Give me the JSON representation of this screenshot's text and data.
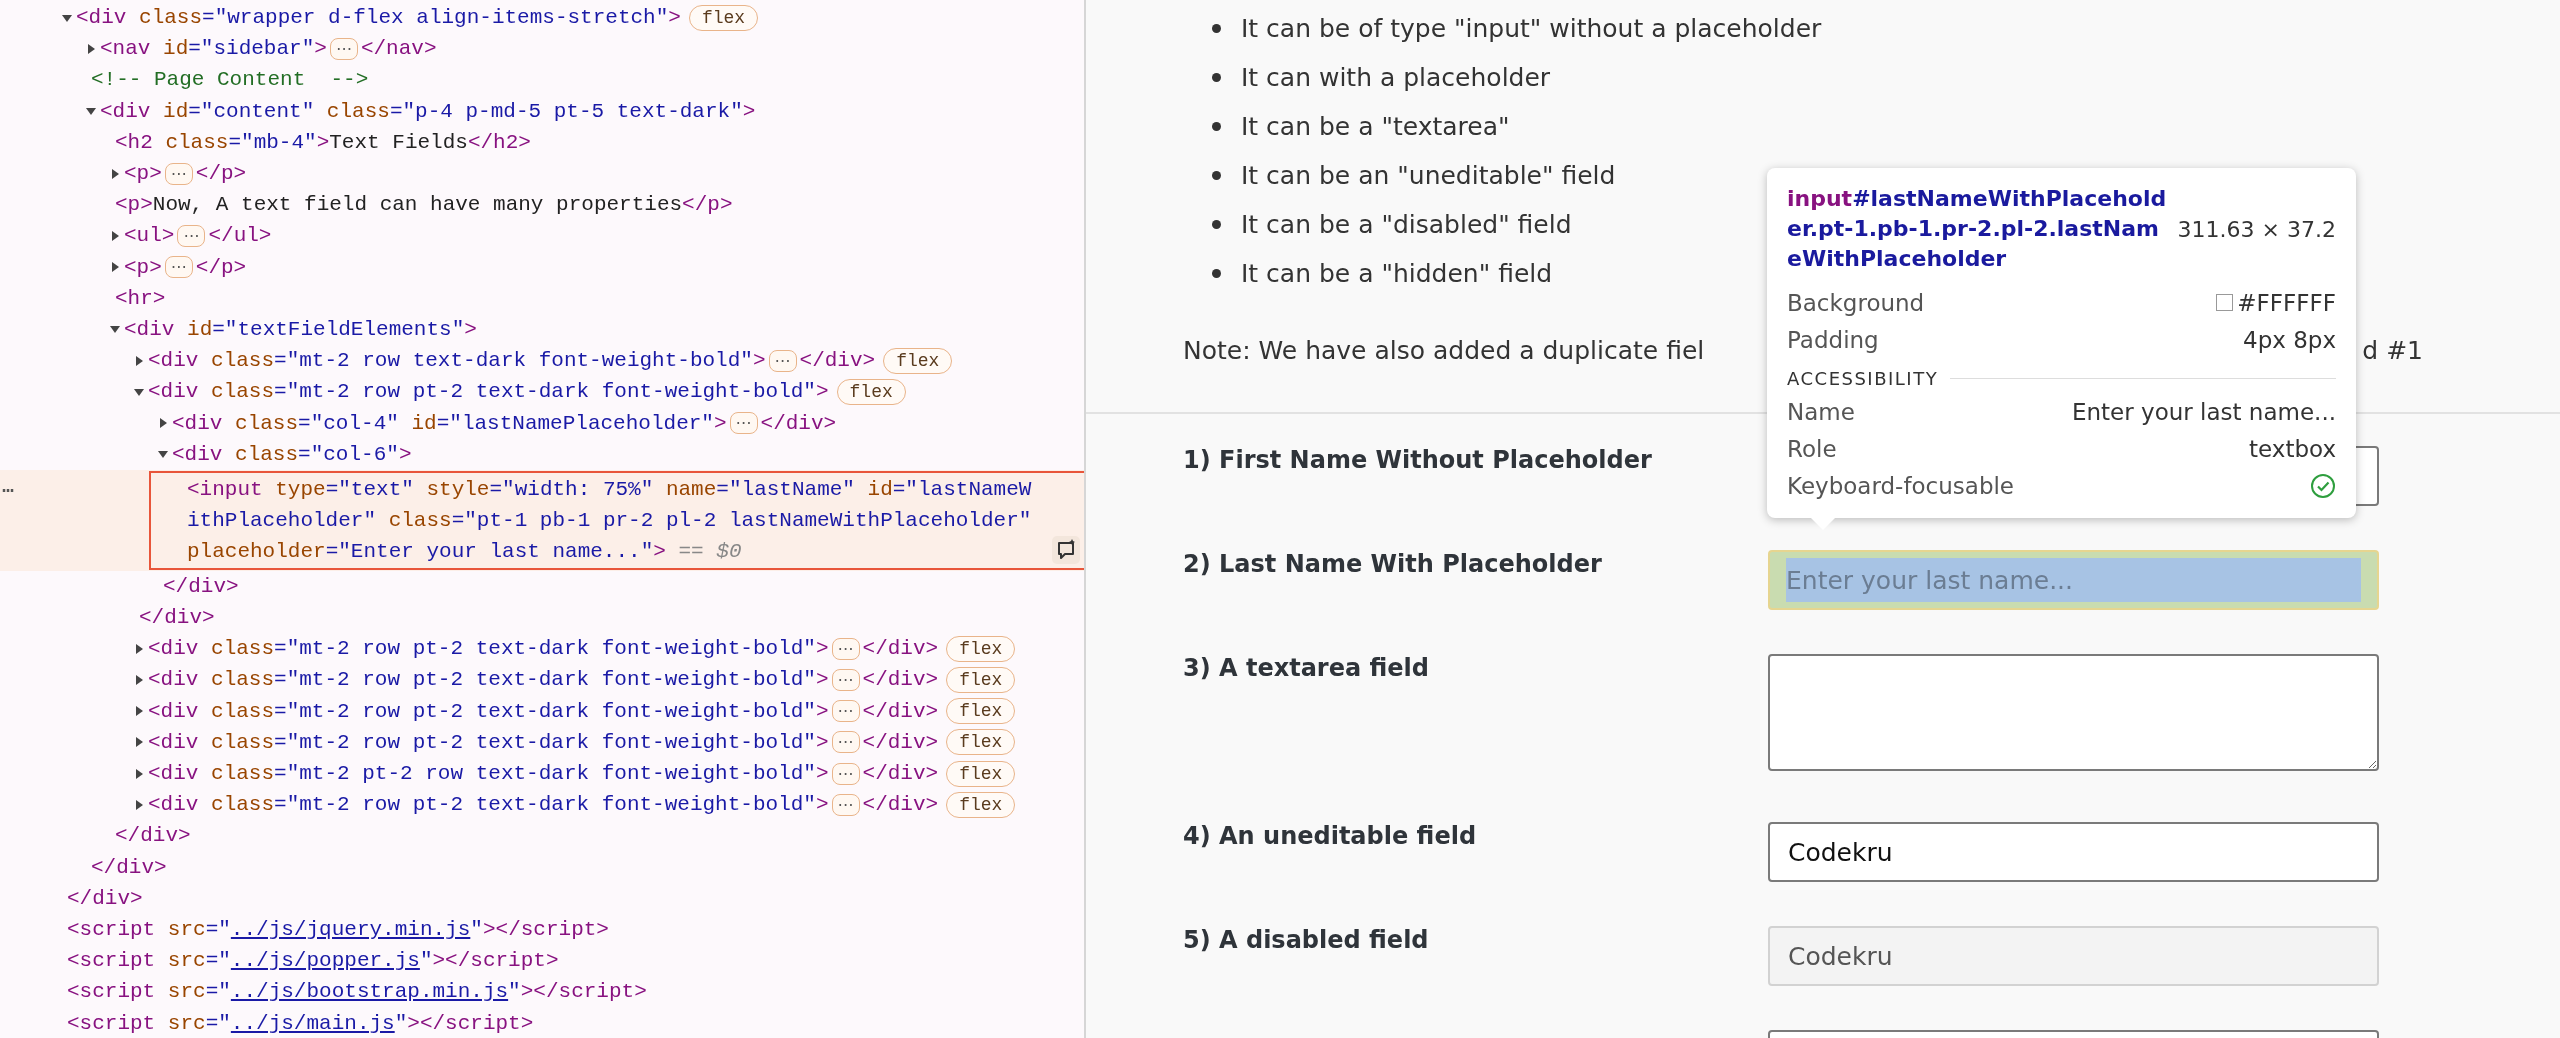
{
  "elements": {
    "selected_marker": "⋯",
    "nodes": [
      {
        "tokens": [
          {
            "kind": "tag",
            "text": "<div"
          },
          {
            "kind": "attr",
            "text": " class"
          },
          {
            "kind": "value",
            "text": "=\"wrapper d-flex align-items-stretch\""
          },
          {
            "kind": "tag",
            "text": ">"
          },
          {
            "kind": "badge",
            "text": "flex"
          }
        ],
        "expanded": true,
        "selected": false,
        "close": [
          {
            "kind": "tag",
            "text": "</div>"
          }
        ],
        "children": [
          {
            "tokens": [
              {
                "kind": "tag",
                "text": "<nav"
              },
              {
                "kind": "attr",
                "text": " id"
              },
              {
                "kind": "value",
                "text": "=\"sidebar\""
              },
              {
                "kind": "tag",
                "text": ">"
              },
              {
                "kind": "ellipsis",
                "text": "⋯"
              },
              {
                "kind": "tag",
                "text": "</nav>"
              }
            ],
            "expanded": false,
            "selected": false
          },
          {
            "tokens": [
              {
                "kind": "comment",
                "text": "<!-- Page Content  -->"
              }
            ],
            "selected": false
          },
          {
            "tokens": [
              {
                "kind": "tag",
                "text": "<div"
              },
              {
                "kind": "attr",
                "text": " id"
              },
              {
                "kind": "value",
                "text": "=\"content\""
              },
              {
                "kind": "attr",
                "text": " class"
              },
              {
                "kind": "value",
                "text": "=\"p-4 p-md-5 pt-5 text-dark\""
              },
              {
                "kind": "tag",
                "text": ">"
              }
            ],
            "expanded": true,
            "selected": false,
            "close": [
              {
                "kind": "tag",
                "text": "</div>"
              }
            ],
            "children": [
              {
                "tokens": [
                  {
                    "kind": "tag",
                    "text": "<h2"
                  },
                  {
                    "kind": "attr",
                    "text": " class"
                  },
                  {
                    "kind": "value",
                    "text": "=\"mb-4\""
                  },
                  {
                    "kind": "tag",
                    "text": ">"
                  },
                  {
                    "kind": "text",
                    "text": "Text Fields"
                  },
                  {
                    "kind": "tag",
                    "text": "</h2>"
                  }
                ],
                "selected": false
              },
              {
                "tokens": [
                  {
                    "kind": "tag",
                    "text": "<p>"
                  },
                  {
                    "kind": "ellipsis",
                    "text": "⋯"
                  },
                  {
                    "kind": "tag",
                    "text": "</p>"
                  }
                ],
                "expanded": false,
                "selected": false
              },
              {
                "tokens": [
                  {
                    "kind": "tag",
                    "text": "<p>"
                  },
                  {
                    "kind": "text",
                    "text": "Now, A text field can have many properties"
                  },
                  {
                    "kind": "tag",
                    "text": "</p>"
                  }
                ],
                "selected": false
              },
              {
                "tokens": [
                  {
                    "kind": "tag",
                    "text": "<ul>"
                  },
                  {
                    "kind": "ellipsis",
                    "text": "⋯"
                  },
                  {
                    "kind": "tag",
                    "text": "</ul>"
                  }
                ],
                "expanded": false,
                "selected": false
              },
              {
                "tokens": [
                  {
                    "kind": "tag",
                    "text": "<p>"
                  },
                  {
                    "kind": "ellipsis",
                    "text": "⋯"
                  },
                  {
                    "kind": "tag",
                    "text": "</p>"
                  }
                ],
                "expanded": false,
                "selected": false
              },
              {
                "tokens": [
                  {
                    "kind": "tag",
                    "text": "<hr>"
                  }
                ],
                "selected": false
              },
              {
                "tokens": [
                  {
                    "kind": "tag",
                    "text": "<div"
                  },
                  {
                    "kind": "attr",
                    "text": " id"
                  },
                  {
                    "kind": "value",
                    "text": "=\"textFieldElements\""
                  },
                  {
                    "kind": "tag",
                    "text": ">"
                  }
                ],
                "expanded": true,
                "selected": false,
                "close": [
                  {
                    "kind": "tag",
                    "text": "</div>"
                  }
                ],
                "children": [
                  {
                    "tokens": [
                      {
                        "kind": "tag",
                        "text": "<div"
                      },
                      {
                        "kind": "attr",
                        "text": " class"
                      },
                      {
                        "kind": "value",
                        "text": "=\"mt-2 row text-dark font-weight-bold\""
                      },
                      {
                        "kind": "tag",
                        "text": ">"
                      },
                      {
                        "kind": "ellipsis",
                        "text": "⋯"
                      },
                      {
                        "kind": "tag",
                        "text": "</div>"
                      },
                      {
                        "kind": "badge",
                        "text": "flex"
                      }
                    ],
                    "expanded": false,
                    "selected": false
                  },
                  {
                    "tokens": [
                      {
                        "kind": "tag",
                        "text": "<div"
                      },
                      {
                        "kind": "attr",
                        "text": " class"
                      },
                      {
                        "kind": "value",
                        "text": "=\"mt-2 row pt-2 text-dark font-weight-bold\""
                      },
                      {
                        "kind": "tag",
                        "text": ">"
                      },
                      {
                        "kind": "badge",
                        "text": "flex"
                      }
                    ],
                    "expanded": true,
                    "selected": false,
                    "close": [
                      {
                        "kind": "tag",
                        "text": "</div>"
                      }
                    ],
                    "children": [
                      {
                        "tokens": [
                          {
                            "kind": "tag",
                            "text": "<div"
                          },
                          {
                            "kind": "attr",
                            "text": " class"
                          },
                          {
                            "kind": "value",
                            "text": "=\"col-4\""
                          },
                          {
                            "kind": "attr",
                            "text": " id"
                          },
                          {
                            "kind": "value",
                            "text": "=\"lastNamePlaceholder\""
                          },
                          {
                            "kind": "tag",
                            "text": ">"
                          },
                          {
                            "kind": "ellipsis",
                            "text": "⋯"
                          },
                          {
                            "kind": "tag",
                            "text": "</div>"
                          }
                        ],
                        "expanded": false,
                        "selected": false
                      },
                      {
                        "tokens": [
                          {
                            "kind": "tag",
                            "text": "<div"
                          },
                          {
                            "kind": "attr",
                            "text": " class"
                          },
                          {
                            "kind": "value",
                            "text": "=\"col-6\""
                          },
                          {
                            "kind": "tag",
                            "text": ">"
                          }
                        ],
                        "expanded": true,
                        "selected": false,
                        "close": [
                          {
                            "kind": "tag",
                            "text": "</div>"
                          }
                        ],
                        "children": [
                          {
                            "tokens": [
                              {
                                "kind": "tag",
                                "text": "<input"
                              },
                              {
                                "kind": "attr",
                                "text": " type"
                              },
                              {
                                "kind": "value",
                                "text": "=\"text\""
                              },
                              {
                                "kind": "attr",
                                "text": " style"
                              },
                              {
                                "kind": "value",
                                "text": "=\"width: 75%\""
                              },
                              {
                                "kind": "attr",
                                "text": " name"
                              },
                              {
                                "kind": "value",
                                "text": "=\"lastName\""
                              },
                              {
                                "kind": "attr",
                                "text": " id"
                              },
                              {
                                "kind": "value",
                                "text": "=\"lastNameWithPlaceholder\""
                              },
                              {
                                "kind": "attr",
                                "text": " class"
                              },
                              {
                                "kind": "value",
                                "text": "=\"pt-1 pb-1 pr-2 pl-2 lastNameWithPlaceholder\""
                              },
                              {
                                "kind": "attr",
                                "text": " placeholder"
                              },
                              {
                                "kind": "value",
                                "text": "=\"Enter your last name...\""
                              },
                              {
                                "kind": "tag",
                                "text": ">"
                              },
                              {
                                "kind": "marker",
                                "text": " == $0"
                              }
                            ],
                            "selected": true
                          }
                        ]
                      }
                    ]
                  },
                  {
                    "tokens": [
                      {
                        "kind": "tag",
                        "text": "<div"
                      },
                      {
                        "kind": "attr",
                        "text": " class"
                      },
                      {
                        "kind": "value",
                        "text": "=\"mt-2 row pt-2 text-dark font-weight-bold\""
                      },
                      {
                        "kind": "tag",
                        "text": ">"
                      },
                      {
                        "kind": "ellipsis",
                        "text": "⋯"
                      },
                      {
                        "kind": "tag",
                        "text": "</div>"
                      },
                      {
                        "kind": "badge",
                        "text": "flex"
                      }
                    ],
                    "expanded": false,
                    "selected": false
                  },
                  {
                    "tokens": [
                      {
                        "kind": "tag",
                        "text": "<div"
                      },
                      {
                        "kind": "attr",
                        "text": " class"
                      },
                      {
                        "kind": "value",
                        "text": "=\"mt-2 row pt-2 text-dark font-weight-bold\""
                      },
                      {
                        "kind": "tag",
                        "text": ">"
                      },
                      {
                        "kind": "ellipsis",
                        "text": "⋯"
                      },
                      {
                        "kind": "tag",
                        "text": "</div>"
                      },
                      {
                        "kind": "badge",
                        "text": "flex"
                      }
                    ],
                    "expanded": false,
                    "selected": false
                  },
                  {
                    "tokens": [
                      {
                        "kind": "tag",
                        "text": "<div"
                      },
                      {
                        "kind": "attr",
                        "text": " class"
                      },
                      {
                        "kind": "value",
                        "text": "=\"mt-2 row pt-2 text-dark font-weight-bold\""
                      },
                      {
                        "kind": "tag",
                        "text": ">"
                      },
                      {
                        "kind": "ellipsis",
                        "text": "⋯"
                      },
                      {
                        "kind": "tag",
                        "text": "</div>"
                      },
                      {
                        "kind": "badge",
                        "text": "flex"
                      }
                    ],
                    "expanded": false,
                    "selected": false
                  },
                  {
                    "tokens": [
                      {
                        "kind": "tag",
                        "text": "<div"
                      },
                      {
                        "kind": "attr",
                        "text": " class"
                      },
                      {
                        "kind": "value",
                        "text": "=\"mt-2 row pt-2 text-dark font-weight-bold\""
                      },
                      {
                        "kind": "tag",
                        "text": ">"
                      },
                      {
                        "kind": "ellipsis",
                        "text": "⋯"
                      },
                      {
                        "kind": "tag",
                        "text": "</div>"
                      },
                      {
                        "kind": "badge",
                        "text": "flex"
                      }
                    ],
                    "expanded": false,
                    "selected": false
                  },
                  {
                    "tokens": [
                      {
                        "kind": "tag",
                        "text": "<div"
                      },
                      {
                        "kind": "attr",
                        "text": " class"
                      },
                      {
                        "kind": "value",
                        "text": "=\"mt-2 pt-2 row text-dark font-weight-bold\""
                      },
                      {
                        "kind": "tag",
                        "text": ">"
                      },
                      {
                        "kind": "ellipsis",
                        "text": "⋯"
                      },
                      {
                        "kind": "tag",
                        "text": "</div>"
                      },
                      {
                        "kind": "badge",
                        "text": "flex"
                      }
                    ],
                    "expanded": false,
                    "selected": false
                  },
                  {
                    "tokens": [
                      {
                        "kind": "tag",
                        "text": "<div"
                      },
                      {
                        "kind": "attr",
                        "text": " class"
                      },
                      {
                        "kind": "value",
                        "text": "=\"mt-2 row pt-2 text-dark font-weight-bold\""
                      },
                      {
                        "kind": "tag",
                        "text": ">"
                      },
                      {
                        "kind": "ellipsis",
                        "text": "⋯"
                      },
                      {
                        "kind": "tag",
                        "text": "</div>"
                      },
                      {
                        "kind": "badge",
                        "text": "flex"
                      }
                    ],
                    "expanded": false,
                    "selected": false
                  }
                ]
              }
            ]
          }
        ]
      },
      {
        "tokens": [
          {
            "kind": "tag",
            "text": "<script"
          },
          {
            "kind": "attr",
            "text": " src"
          },
          {
            "kind": "value",
            "text": "=\""
          },
          {
            "kind": "link",
            "text": "../js/jquery.min.js"
          },
          {
            "kind": "value",
            "text": "\""
          },
          {
            "kind": "tag",
            "text": "></script>"
          }
        ],
        "selected": false
      },
      {
        "tokens": [
          {
            "kind": "tag",
            "text": "<script"
          },
          {
            "kind": "attr",
            "text": " src"
          },
          {
            "kind": "value",
            "text": "=\""
          },
          {
            "kind": "link",
            "text": "../js/popper.js"
          },
          {
            "kind": "value",
            "text": "\""
          },
          {
            "kind": "tag",
            "text": "></script>"
          }
        ],
        "selected": false
      },
      {
        "tokens": [
          {
            "kind": "tag",
            "text": "<script"
          },
          {
            "kind": "attr",
            "text": " src"
          },
          {
            "kind": "value",
            "text": "=\""
          },
          {
            "kind": "link",
            "text": "../js/bootstrap.min.js"
          },
          {
            "kind": "value",
            "text": "\""
          },
          {
            "kind": "tag",
            "text": "></script>"
          }
        ],
        "selected": false
      },
      {
        "tokens": [
          {
            "kind": "tag",
            "text": "<script"
          },
          {
            "kind": "attr",
            "text": " src"
          },
          {
            "kind": "value",
            "text": "=\""
          },
          {
            "kind": "link",
            "text": "../js/main.js"
          },
          {
            "kind": "value",
            "text": "\""
          },
          {
            "kind": "tag",
            "text": "></script>"
          }
        ],
        "selected": false
      }
    ]
  },
  "page": {
    "bullets": [
      "It can be of type \"input\" without a placeholder",
      "It can with a placeholder",
      "It can be a \"textarea\"",
      "It can be an \"uneditable\" field",
      "It can be a \"disabled\" field",
      "It can be a \"hidden\" field"
    ],
    "note": {
      "before": "Note: We have also added a duplicate fiel",
      "after": "d #1"
    },
    "rows": [
      {
        "label": "1) First Name Without Placeholder",
        "field": {
          "kind": "input",
          "disabled": false,
          "highlighted": false
        }
      },
      {
        "label": "2) Last Name With Placeholder",
        "field": {
          "kind": "input",
          "placeholder": "Enter your last name...",
          "disabled": false,
          "highlighted": true
        }
      },
      {
        "label": "3) A textarea field",
        "field": {
          "kind": "textarea",
          "disabled": false,
          "highlighted": false
        }
      },
      {
        "label": "4) An uneditable field",
        "field": {
          "kind": "input",
          "value": "Codekru",
          "disabled": false,
          "highlighted": false
        }
      },
      {
        "label": "5) A disabled field",
        "field": {
          "kind": "input",
          "value": "Codekru",
          "disabled": true,
          "highlighted": false
        }
      },
      {
        "field": {
          "kind": "input",
          "disabled": false,
          "highlighted": false
        }
      }
    ]
  },
  "tooltip": {
    "tag": "input",
    "selector": "#lastNameWithPlaceholder.pt-1.pb-1.pr-2.pl-2.lastNameWithPlaceholder",
    "size": "311.63 × 37.2",
    "properties": [
      {
        "label": "Background",
        "value": "#FFFFFF",
        "kind": "color"
      },
      {
        "label": "Padding",
        "value": "4px 8px",
        "kind": "text"
      }
    ],
    "section": "ACCESSIBILITY",
    "accessibility": [
      {
        "label": "Name",
        "value": "Enter your last name...",
        "kind": "text"
      },
      {
        "label": "Role",
        "value": "textbox",
        "kind": "text"
      },
      {
        "label": "Keyboard-focusable",
        "kind": "check"
      }
    ]
  }
}
